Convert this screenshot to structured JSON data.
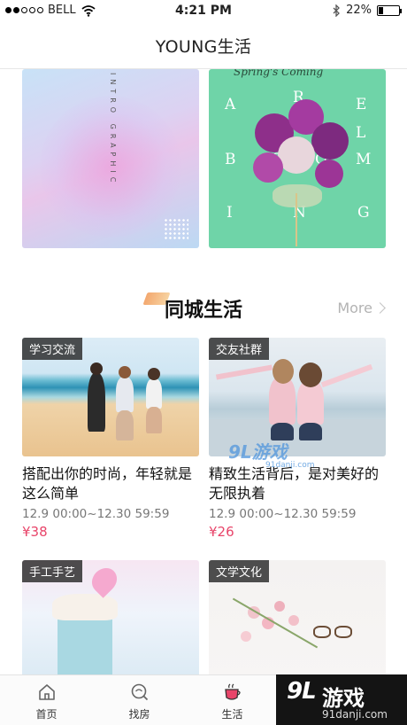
{
  "status_bar": {
    "carrier": "BELL",
    "time": "4:21 PM",
    "battery": "22%",
    "battery_level": 0.22,
    "icons": [
      "signal-dots-icon",
      "wifi-icon",
      "bluetooth-icon",
      "battery-icon"
    ]
  },
  "nav": {
    "title": "YOUNG生活"
  },
  "banners": {
    "left": {
      "vertical_text": "INTRO GRAPHIC"
    },
    "right": {
      "script": "Spring's Coming",
      "letters": [
        "A",
        "B",
        "I",
        "R",
        "E",
        "L",
        "O",
        "O",
        "M",
        "N",
        "G"
      ]
    }
  },
  "section": {
    "title": "同城生活",
    "more": "More"
  },
  "cards": [
    {
      "tag": "学习交流",
      "title": "搭配出你的时尚，年轻就是这么简单",
      "date": "12.9 00:00~12.30 59:59",
      "price": "¥38"
    },
    {
      "tag": "交友社群",
      "title": "精致生活背后，是对美好的无限执着",
      "date": "12.9 00:00~12.30 59:59",
      "price": "¥26"
    },
    {
      "tag": "手工手艺"
    },
    {
      "tag": "文学文化"
    }
  ],
  "tabs": [
    {
      "label": "首页",
      "icon": "home-icon"
    },
    {
      "label": "找房",
      "icon": "search-house-icon"
    },
    {
      "label": "生活",
      "icon": "coffee-cup-icon",
      "active": true
    }
  ],
  "watermark": {
    "logo": "9L",
    "text": "游戏",
    "url": "91danji.com"
  },
  "overlay_watermark": {
    "text": "9L游戏",
    "url": "91danji.com"
  },
  "colors": {
    "accent_price": "#e8456a",
    "more_gray": "#b3b3b3",
    "tag_bg": "#282828"
  }
}
